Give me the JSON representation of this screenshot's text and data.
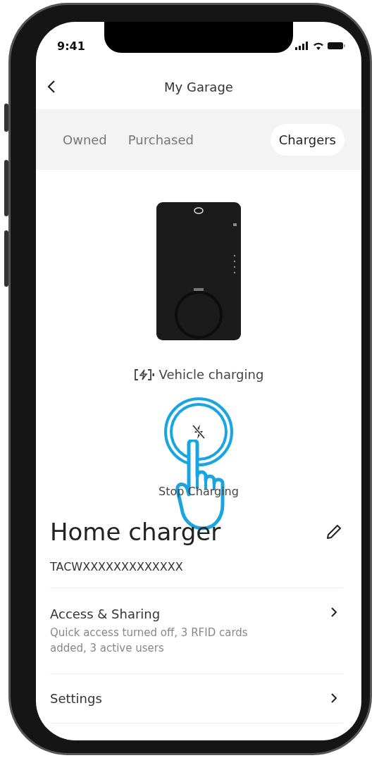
{
  "status_bar": {
    "time": "9:41"
  },
  "header": {
    "title": "My Garage"
  },
  "tabs": [
    {
      "label": "Owned",
      "selected": false
    },
    {
      "label": "Purchased",
      "selected": false
    },
    {
      "label": "Chargers",
      "selected": true
    }
  ],
  "charger": {
    "status": "Vehicle charging",
    "action": "Stop Charging",
    "name": "Home charger",
    "serial": "TACWXXXXXXXXXXXXX"
  },
  "rows": [
    {
      "title": "Access & Sharing",
      "subtitle": "Quick access turned off, 3 RFID cards added, 3 active users"
    },
    {
      "title": "Settings"
    }
  ]
}
